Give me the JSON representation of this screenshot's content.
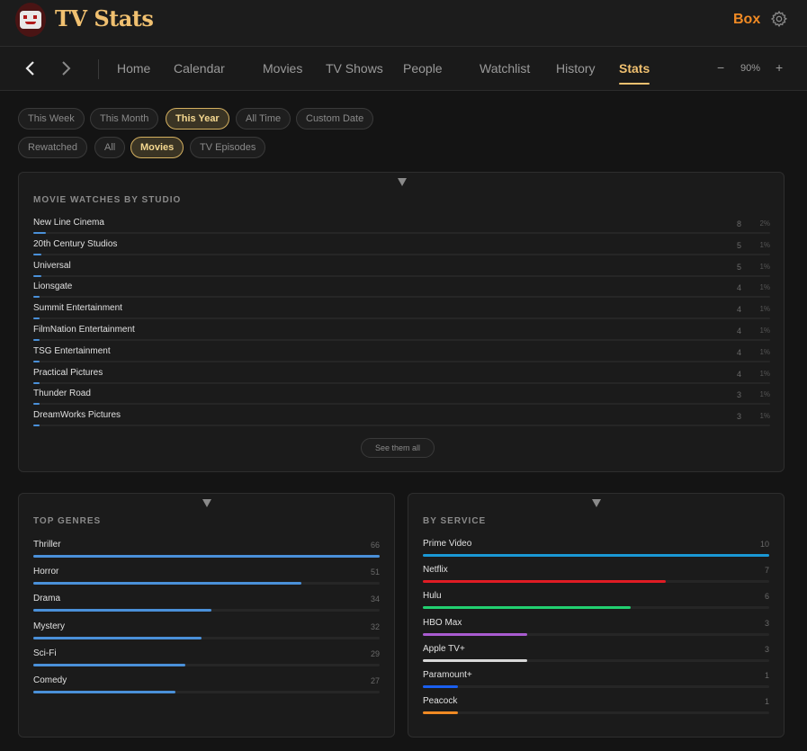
{
  "app": {
    "title": "TV Stats",
    "user": "Box"
  },
  "nav": {
    "items": [
      "Home",
      "Calendar",
      "Movies",
      "TV Shows",
      "People",
      "Watchlist",
      "History",
      "Stats"
    ],
    "active": "Stats",
    "zoom": "90%",
    "zoom_minus": "−",
    "zoom_plus": "+"
  },
  "filters": {
    "period": [
      "This Week",
      "This Month",
      "This Year",
      "All Time",
      "Custom Date"
    ],
    "period_active": "This Year",
    "type": [
      "Rewatched",
      "All",
      "Movies",
      "TV Episodes"
    ],
    "type_active": "Movies"
  },
  "studios": {
    "title": "MOVIE WATCHES BY STUDIO",
    "see_all": "See them all",
    "max": 8,
    "rows": [
      {
        "name": "New Line Cinema",
        "count": 8,
        "pct": "2%"
      },
      {
        "name": "20th Century Studios",
        "count": 5,
        "pct": "1%"
      },
      {
        "name": "Universal",
        "count": 5,
        "pct": "1%"
      },
      {
        "name": "Lionsgate",
        "count": 4,
        "pct": "1%"
      },
      {
        "name": "Summit Entertainment",
        "count": 4,
        "pct": "1%"
      },
      {
        "name": "FilmNation Entertainment",
        "count": 4,
        "pct": "1%"
      },
      {
        "name": "TSG Entertainment",
        "count": 4,
        "pct": "1%"
      },
      {
        "name": "Practical Pictures",
        "count": 4,
        "pct": "1%"
      },
      {
        "name": "Thunder Road",
        "count": 3,
        "pct": "1%"
      },
      {
        "name": "DreamWorks Pictures",
        "count": 3,
        "pct": "1%"
      }
    ]
  },
  "genres": {
    "title": "TOP GENRES",
    "max": 66,
    "color": "#4a90d9",
    "rows": [
      {
        "name": "Thriller",
        "count": 66
      },
      {
        "name": "Horror",
        "count": 51
      },
      {
        "name": "Drama",
        "count": 34
      },
      {
        "name": "Mystery",
        "count": 32
      },
      {
        "name": "Sci-Fi",
        "count": 29
      },
      {
        "name": "Comedy",
        "count": 27
      }
    ]
  },
  "services": {
    "title": "BY SERVICE",
    "max": 10,
    "rows": [
      {
        "name": "Prime Video",
        "count": 10,
        "color": "#1a98d5"
      },
      {
        "name": "Netflix",
        "count": 7,
        "color": "#e01c24"
      },
      {
        "name": "Hulu",
        "count": 6,
        "color": "#22d070"
      },
      {
        "name": "HBO Max",
        "count": 3,
        "color": "#a95bd0"
      },
      {
        "name": "Apple TV+",
        "count": 3,
        "color": "#d8d8d8"
      },
      {
        "name": "Paramount+",
        "count": 1,
        "color": "#1a5ff0"
      },
      {
        "name": "Peacock",
        "count": 1,
        "color": "#f08a24"
      }
    ]
  }
}
